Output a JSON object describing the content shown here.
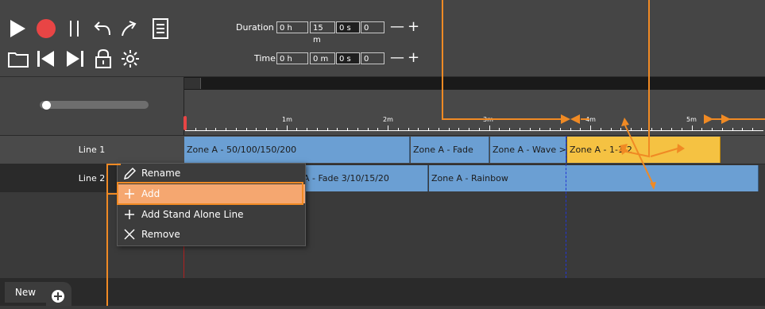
{
  "toolbar": {
    "play_icon": "play-icon",
    "record_icon": "record-icon",
    "pause_icon": "pause-icon",
    "undo_icon": "undo-icon",
    "redo_icon": "redo-icon",
    "notes_icon": "notes-icon",
    "folder_icon": "folder-icon",
    "prev_icon": "skip-back-icon",
    "next_icon": "skip-forward-icon",
    "lock_icon": "lock-icon",
    "settings_icon": "gear-icon"
  },
  "duration": {
    "label": "Duration :",
    "hours": "0 h",
    "minutes": "15 m",
    "seconds": "0 s",
    "frames": "0",
    "minus": "—",
    "plus": "+"
  },
  "time": {
    "label": "Time :",
    "hours": "0 h",
    "minutes": "0 m",
    "seconds": "0 s",
    "frames": "0",
    "minus": "—",
    "plus": "+"
  },
  "slider": {
    "value": 0.03
  },
  "ruler": {
    "labels": [
      "1m",
      "2m",
      "3m",
      "4m",
      "5m"
    ]
  },
  "lines": [
    {
      "label": "Line 1",
      "clips": [
        {
          "text": "Zone A - 50/100/150/200",
          "color": "#6b9fd3"
        },
        {
          "text": "Zone A - Fade",
          "color": "#6b9fd3"
        },
        {
          "text": "Zone A - Wave >",
          "color": "#6b9fd3"
        },
        {
          "text": "Zone A - 1-1-2",
          "color": "#f5c242"
        }
      ]
    },
    {
      "label": "Line 2",
      "clips": [
        {
          "text": "A - Fade 3/10/15/20",
          "color": "#6b9fd3"
        },
        {
          "text": "Zone A - Rainbow",
          "color": "#6b9fd3"
        }
      ]
    }
  ],
  "context_menu": {
    "items": [
      {
        "label": "Rename",
        "icon": "pencil-icon"
      },
      {
        "label": "Add",
        "icon": "plus-icon"
      },
      {
        "label": "Add Stand Alone Line",
        "icon": "plus-icon"
      },
      {
        "label": "Remove",
        "icon": "close-icon"
      }
    ]
  },
  "tabs": {
    "current": "New",
    "add_icon": "add-tab-icon"
  },
  "colors": {
    "accent_orange": "#f08a24",
    "clip_blue": "#6b9fd3",
    "clip_yellow": "#f5c242",
    "record_red": "#e84545"
  }
}
